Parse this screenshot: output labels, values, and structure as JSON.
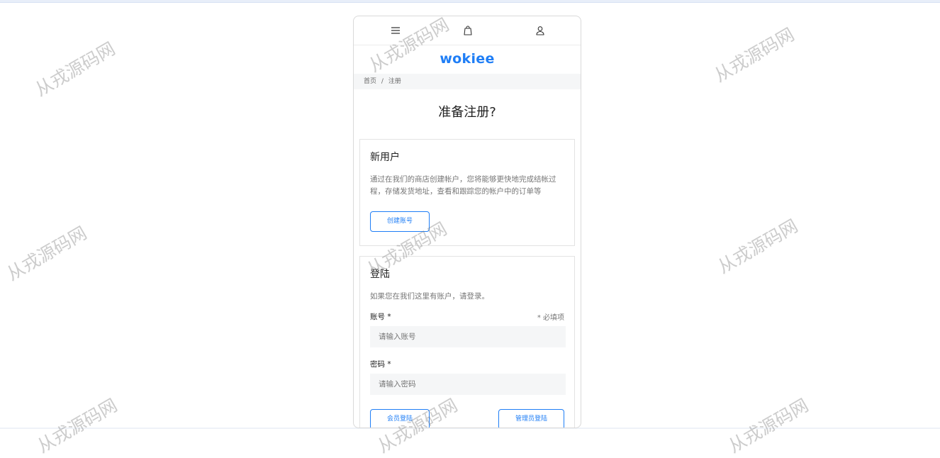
{
  "header": {
    "icons": [
      "menu-icon",
      "shopping-bag-icon",
      "user-icon"
    ],
    "logo": "wokiee"
  },
  "breadcrumb": {
    "home": "首页",
    "separator": "/",
    "current": "注册"
  },
  "page_title": "准备注册?",
  "new_user": {
    "heading": "新用户",
    "description": "通过在我们的商店创建帐户，您将能够更快地完成结帐过程，存储发货地址，查看和跟踪您的帐户中的订单等",
    "create_button": "创建账号"
  },
  "login": {
    "heading": "登陆",
    "description": "如果您在我们这里有账户，请登录。",
    "account_label": "账号 *",
    "required_note": "* 必填项",
    "account_placeholder": "请输入账号",
    "password_label": "密码 *",
    "password_placeholder": "请输入密码",
    "member_login_button": "会员登陆",
    "admin_login_button": "管理员登陆"
  },
  "watermark": "从戎源码网",
  "colors": {
    "accent": "#1f7ef6",
    "input_bg": "#f5f6f7"
  }
}
